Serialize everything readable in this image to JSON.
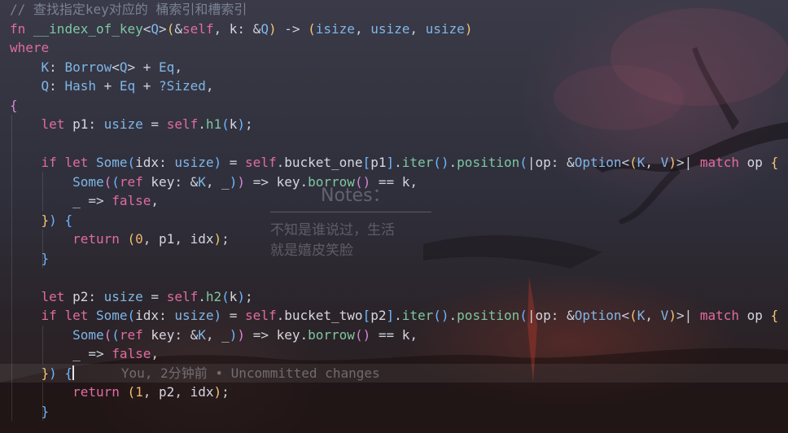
{
  "editor": {
    "comment": "// 查找指定key对应的 桶索引和槽索引",
    "blame": "You, 2分钟前 • Uncommitted changes"
  },
  "notes": {
    "title": "Notes：",
    "lines": [
      "不知是谁说过，生活",
      "就是嬉皮笑脸"
    ]
  },
  "tokens": {
    "fn": "fn",
    "name": "__index_of_key",
    "Q": "Q",
    "self": "self",
    "k": "k",
    "isize": "isize",
    "usize": "usize",
    "where": "where",
    "K": "K",
    "Borrow": "Borrow",
    "Eq": "Eq",
    "Hash": "Hash",
    "Sized": "?Sized",
    "let": "let",
    "p1": "p1",
    "p2": "p2",
    "h1": "h1",
    "h2": "h2",
    "if": "if",
    "Some": "Some",
    "idx": "idx",
    "bucket_one": "bucket_one",
    "bucket_two": "bucket_two",
    "iter": "iter",
    "position": "position",
    "op": "op",
    "Option": "Option",
    "V": "V",
    "match": "match",
    "ref": "ref",
    "key": "key",
    "borrow": "borrow",
    "false": "false",
    "return": "return",
    "zero": "0",
    "one": "1"
  },
  "colors": {
    "keyword": "#e06c9f",
    "function": "#7ec7a0",
    "type": "#7fb6e6",
    "number": "#f0b36a",
    "comment": "#7a8193"
  }
}
